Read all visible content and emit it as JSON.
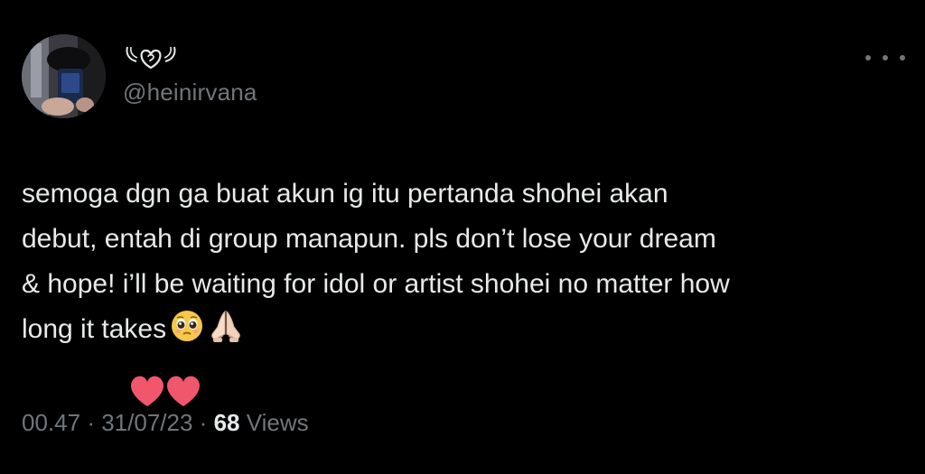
{
  "tweet": {
    "display_name_icon": "angel-heart-icon",
    "handle": "@heinirvana",
    "more_icon": "more-dots-icon",
    "body_lines": [
      "semoga dgn ga buat akun ig itu pertanda shohei akan",
      "debut, entah di group manapun. pls don’t lose your dream",
      "& hope! i’ll be waiting for idol or artist shohei no matter how",
      "long it takes"
    ],
    "emojis": [
      "pleading-face-emoji",
      "folded-hands-emoji"
    ],
    "decoration": "two-pink-hearts",
    "time": "00.47",
    "separator": "·",
    "date": "31/07/23",
    "views_count": "68",
    "views_label": "Views"
  },
  "colors": {
    "background": "#000000",
    "text_primary": "#e7e9ea",
    "text_secondary": "#71767b",
    "heart": "#f0576d"
  }
}
